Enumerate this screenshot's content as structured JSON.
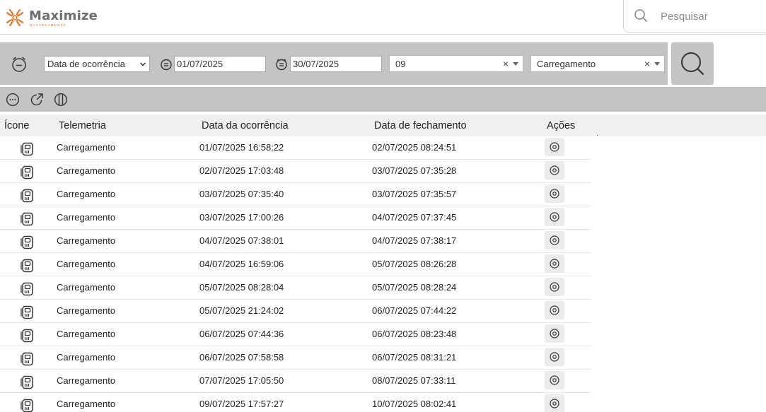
{
  "brand": {
    "name": "Maximize",
    "subtitle": "RASTREAMENTO",
    "colors": {
      "orange": "#e8772e",
      "gray": "#6e6e6e"
    }
  },
  "header": {
    "search_placeholder": "Pesquisar"
  },
  "filters": {
    "date_type": {
      "selected": "Data de ocorrência",
      "options": [
        "Data de ocorrência"
      ]
    },
    "start_date": "01/07/2025",
    "end_date": "30/07/2025",
    "vehicle": {
      "value": "09",
      "clear": "×"
    },
    "telemetry_type": {
      "value": "Carregamento",
      "clear": "×"
    }
  },
  "toolbar": {
    "icons": [
      "more-icon",
      "export-icon",
      "columns-icon"
    ]
  },
  "table": {
    "headers": {
      "icon": "Ícone",
      "telemetry": "Telemetria",
      "occurrence_date": "Data da ocorrência",
      "closing_date": "Data de fechamento",
      "actions": "Ações"
    },
    "rows": [
      {
        "telemetry": "Carregamento",
        "occurrence": "01/07/2025 16:58:22",
        "closing": "02/07/2025 08:24:51"
      },
      {
        "telemetry": "Carregamento",
        "occurrence": "02/07/2025 17:03:48",
        "closing": "03/07/2025 07:35:28"
      },
      {
        "telemetry": "Carregamento",
        "occurrence": "03/07/2025 07:35:40",
        "closing": "03/07/2025 07:35:57"
      },
      {
        "telemetry": "Carregamento",
        "occurrence": "03/07/2025 17:00:26",
        "closing": "04/07/2025 07:37:45"
      },
      {
        "telemetry": "Carregamento",
        "occurrence": "04/07/2025 07:38:01",
        "closing": "04/07/2025 07:38:17"
      },
      {
        "telemetry": "Carregamento",
        "occurrence": "04/07/2025 16:59:06",
        "closing": "05/07/2025 08:26:28"
      },
      {
        "telemetry": "Carregamento",
        "occurrence": "05/07/2025 08:28:04",
        "closing": "05/07/2025 08:28:24"
      },
      {
        "telemetry": "Carregamento",
        "occurrence": "05/07/2025 21:24:02",
        "closing": "06/07/2025 07:44:22"
      },
      {
        "telemetry": "Carregamento",
        "occurrence": "06/07/2025 07:44:36",
        "closing": "06/07/2025 08:23:48"
      },
      {
        "telemetry": "Carregamento",
        "occurrence": "06/07/2025 07:58:58",
        "closing": "06/07/2025 08:31:21"
      },
      {
        "telemetry": "Carregamento",
        "occurrence": "07/07/2025 17:05:50",
        "closing": "08/07/2025 07:33:11"
      },
      {
        "telemetry": "Carregamento",
        "occurrence": "09/07/2025 17:57:27",
        "closing": "10/07/2025 08:02:41"
      }
    ]
  }
}
